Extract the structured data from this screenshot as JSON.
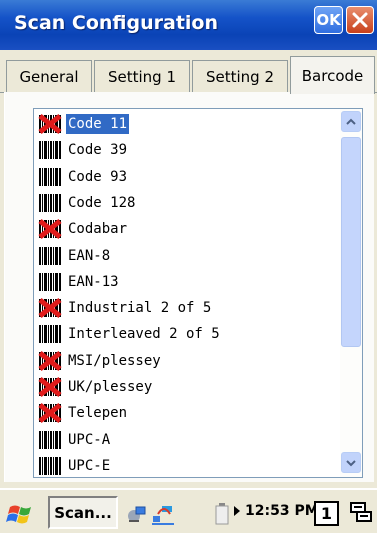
{
  "window": {
    "title": "Scan Configuration",
    "ok_label": "OK"
  },
  "tabs": [
    {
      "label": "General",
      "active": false
    },
    {
      "label": "Setting 1",
      "active": false
    },
    {
      "label": "Setting 2",
      "active": false
    },
    {
      "label": "Barcode",
      "active": true
    }
  ],
  "barcode_list": {
    "selected_index": 0,
    "items": [
      {
        "label": "Code 11",
        "enabled": false
      },
      {
        "label": "Code 39",
        "enabled": true
      },
      {
        "label": "Code 93",
        "enabled": true
      },
      {
        "label": "Code 128",
        "enabled": true
      },
      {
        "label": "Codabar",
        "enabled": false
      },
      {
        "label": "EAN-8",
        "enabled": true
      },
      {
        "label": "EAN-13",
        "enabled": true
      },
      {
        "label": "Industrial 2 of 5",
        "enabled": false
      },
      {
        "label": "Interleaved 2 of 5",
        "enabled": true
      },
      {
        "label": "MSI/plessey",
        "enabled": false
      },
      {
        "label": "UK/plessey",
        "enabled": false
      },
      {
        "label": "Telepen",
        "enabled": false
      },
      {
        "label": "UPC-A",
        "enabled": true
      },
      {
        "label": "UPC-E",
        "enabled": true
      }
    ]
  },
  "taskbar": {
    "task_label": "Scan...",
    "clock": "12:53 PM",
    "desktop_number": "1"
  },
  "colors": {
    "title_bar": "#0a43b6",
    "selection": "#316ac5",
    "disabled_mark": "#e01b1b"
  },
  "icons": {
    "enabled_item": "barcode-icon",
    "disabled_item": "barcode-disabled-icon"
  }
}
